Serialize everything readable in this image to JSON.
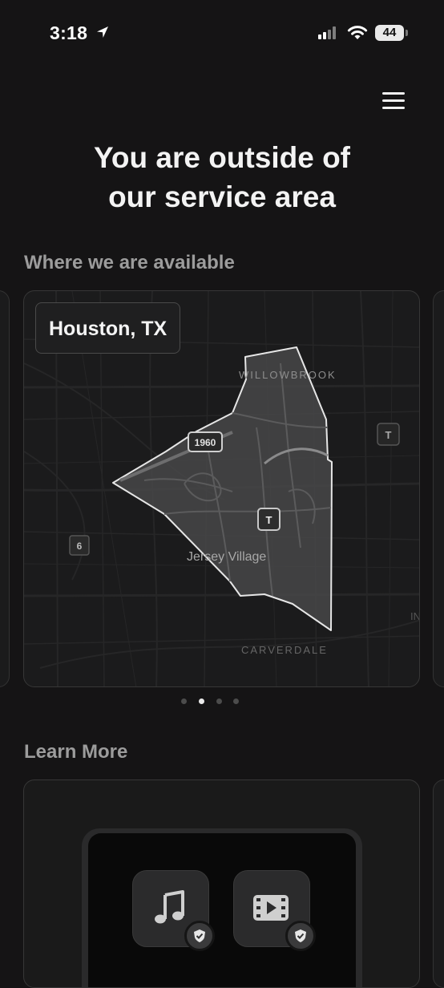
{
  "status": {
    "time": "3:18",
    "battery": "44"
  },
  "header": {
    "title_line1": "You are outside of",
    "title_line2": "our service area"
  },
  "availability": {
    "section_title": "Where we are available",
    "city": "Houston, TX",
    "map_labels": {
      "willowbrook": "WILLOWBROOK",
      "jersey_village": "Jersey Village",
      "carverdale": "CARVERDALE",
      "hwy_1960": "1960",
      "hwy_6": "6",
      "toll_a": "T",
      "toll_b": "T",
      "edge_label": "IN"
    },
    "pagination": {
      "count": 4,
      "active_index": 1
    }
  },
  "learn_more": {
    "section_title": "Learn More"
  },
  "icons": {
    "location": "location-arrow-icon",
    "menu": "hamburger-menu-icon",
    "music": "music-note-icon",
    "video": "video-film-icon",
    "shield": "shield-check-icon"
  },
  "colors": {
    "background": "#151415",
    "service_area_outline": "#e6e6e6",
    "text_muted": "#9c9c9c"
  }
}
